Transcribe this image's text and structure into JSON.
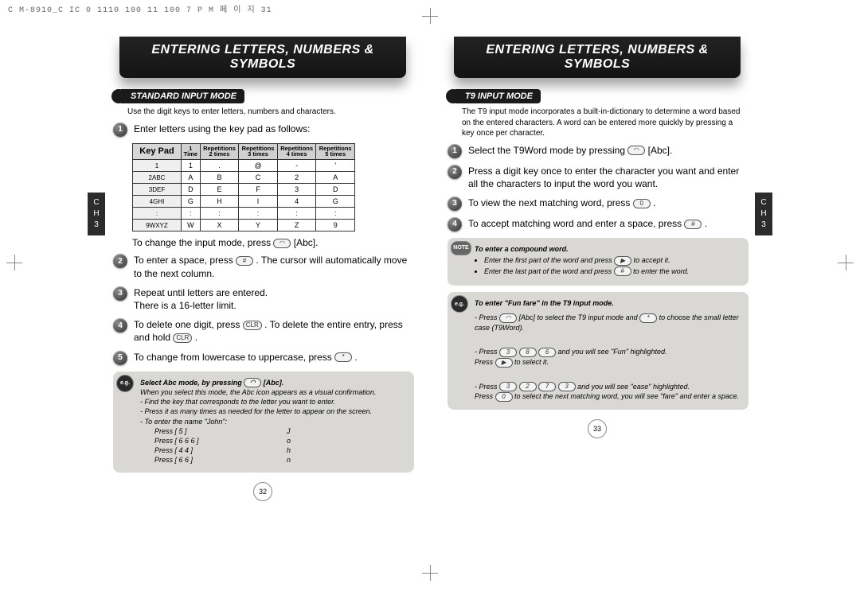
{
  "meta_line": "C M-8910_C IC    0 1110  100 11 100  7 P M 페 이 지 31",
  "left": {
    "banner": "ENTERING LETTERS, NUMBERS & SYMBOLS",
    "section_label": "STANDARD INPUT MODE",
    "intro": "Use the digit keys to enter letters, numbers and characters.",
    "side_tab": "C\nH\n3",
    "step1": "Enter letters using the key pad as follows:",
    "keypad_headers": [
      "Key Pad",
      "1\nTime",
      "Repetitions\n2 times",
      "Repetitions\n3 times",
      "Repetitions\n4 times",
      "Repetitions\n5 times"
    ],
    "keypad_rows": [
      [
        "1",
        "1",
        ".",
        "@",
        "-",
        "'"
      ],
      [
        "2ABC",
        "A",
        "B",
        "C",
        "2",
        "A"
      ],
      [
        "3DEF",
        "D",
        "E",
        "F",
        "3",
        "D"
      ],
      [
        "4GHI",
        "G",
        "H",
        "I",
        "4",
        "G"
      ],
      [
        ":",
        ":",
        ":",
        ":",
        ":",
        ":"
      ],
      [
        "9WXYZ",
        "W",
        "X",
        "Y",
        "Z",
        "9"
      ]
    ],
    "sub_change_mode_a": "To change the input mode, press ",
    "sub_change_mode_b": " [Abc].",
    "step2": "To enter a space, press ",
    "step2_b": " . The cursor will automatically move to the next column.",
    "step3": "Repeat until letters are entered.\nThere is a 16-letter limit.",
    "step4_a": "To delete one digit, press ",
    "step4_b": " . To delete the entire entry, press and hold ",
    "step4_c": " .",
    "step5_a": "To change from lowercase to uppercase, press ",
    "step5_b": " .",
    "eg_lead": "Select Abc mode, by pressing ",
    "eg_lead_b": " [Abc].",
    "eg_body1": "When you select this mode, the Abc icon appears as a visual confirmation.",
    "eg_body2": "- Find the key that corresponds to the letter you want to enter.",
    "eg_body3": "- Press it as many times as needed for the letter to appear on the screen.",
    "eg_body4": "- To enter the name \"John\":",
    "eg_press": [
      {
        "a": "Press [ 5 ]",
        "b": "J"
      },
      {
        "a": "Press [ 6 6 6 ]",
        "b": "o"
      },
      {
        "a": "Press [ 4 4 ]",
        "b": "h"
      },
      {
        "a": "Press [ 6 6 ]",
        "b": "n"
      }
    ],
    "page_num": "32"
  },
  "right": {
    "banner": "ENTERING LETTERS, NUMBERS & SYMBOLS",
    "section_label": "T9 INPUT MODE",
    "intro": "The T9 input mode incorporates a built-in-dictionary to determine a word based on the entered characters. A word can be entered more quickly by pressing a key once per character.",
    "side_tab": "C\nH\n3",
    "step1_a": "Select the T9Word mode by pressing ",
    "step1_b": " [Abc].",
    "step2": "Press a digit key once to enter the character you want and enter all the characters to input the word you want.",
    "step3_a": "To view the next matching word, press ",
    "step3_b": " .",
    "step4_a": "To accept matching word and enter a space, press ",
    "step4_b": " .",
    "note_lead": "To enter a compound word.",
    "note_li1_a": "Enter the first part of the word and press ",
    "note_li1_b": " to accept it.",
    "note_li2_a": "Enter the last part of the word and press ",
    "note_li2_b": " to enter the word.",
    "eg_lead": "To enter \"Fun fare\" in the T9 input mode.",
    "eg_l1_a": "- Press ",
    "eg_l1_b": " [Abc] to select the T9 input mode and ",
    "eg_l1_c": " to choose the small letter case (T9Word).",
    "eg_l2_a": "- Press ",
    "eg_l2_keys": "3 8 6",
    "eg_l2_b": " and you will see \"Fun\" highlighted.\n   Press ",
    "eg_l2_c": " to select it.",
    "eg_l3_a": "- Press ",
    "eg_l3_keys": "3 2 7 3",
    "eg_l3_b": " and you will see \"ease\" highlighted.\n   Press ",
    "eg_l3_c": " to select the next matching word, you will see \"fare\" and enter a space.",
    "page_num": "33"
  }
}
